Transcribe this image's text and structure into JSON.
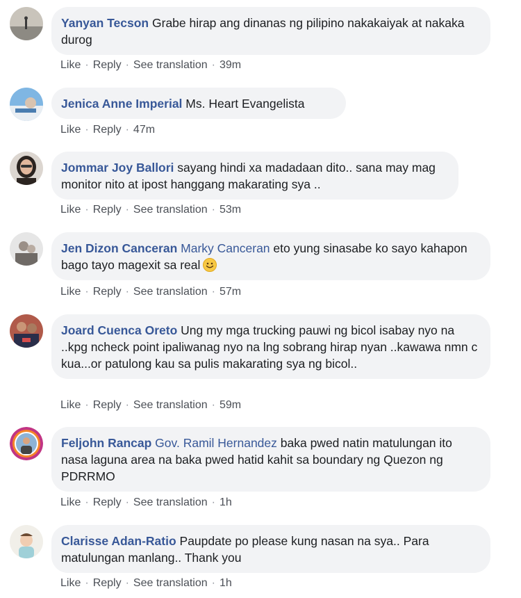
{
  "comments": [
    {
      "author": "Yanyan Tecson",
      "mention": "",
      "text": "Grabe hirap ang dinanas ng pilipino nakakaiyak at nakaka durog",
      "actions": {
        "like": "Like",
        "reply": "Reply",
        "translate": "See translation",
        "time": "39m"
      }
    },
    {
      "author": "Jenica Anne Imperial",
      "mention": "",
      "text": "Ms. Heart Evangelista",
      "actions": {
        "like": "Like",
        "reply": "Reply",
        "translate": "",
        "time": "47m"
      }
    },
    {
      "author": "Jommar Joy Ballori",
      "mention": "",
      "text": "sayang hindi xa madadaan dito.. sana may mag monitor nito at ipost hanggang makarating sya ..",
      "actions": {
        "like": "Like",
        "reply": "Reply",
        "translate": "See translation",
        "time": "53m"
      }
    },
    {
      "author": "Jen Dizon Canceran",
      "mention": "Marky Canceran",
      "text": "eto yung sinasabe ko sayo kahapon bago tayo magexit sa real",
      "emoji": "smiley-emoji",
      "actions": {
        "like": "Like",
        "reply": "Reply",
        "translate": "See translation",
        "time": "57m"
      }
    },
    {
      "author": "Joard Cuenca Oreto",
      "mention": "",
      "text": "Ung my mga trucking pauwi ng bicol isabay nyo na ..kpg ncheck point ipaliwanag nyo na lng sobrang hirap nyan ..kawawa nmn c kua...or patulong kau sa pulis makarating sya ng bicol..",
      "actions": {
        "like": "Like",
        "reply": "Reply",
        "translate": "See translation",
        "time": "59m"
      }
    },
    {
      "author": "Feljohn Rancap",
      "mention": "Gov. Ramil Hernandez",
      "text": "baka pwed natin matulungan ito nasa laguna area na baka pwed hatid kahit sa boundary ng Quezon ng PDRRMO",
      "actions": {
        "like": "Like",
        "reply": "Reply",
        "translate": "See translation",
        "time": "1h"
      }
    },
    {
      "author": "Clarisse Adan-Ratio",
      "mention": "",
      "text": "Paupdate po please kung nasan na sya.. Para matulungan manlang.. Thank you",
      "actions": {
        "like": "Like",
        "reply": "Reply",
        "translate": "See translation",
        "time": "1h"
      }
    }
  ],
  "colors": {
    "author": "#385898",
    "bubble": "#f2f3f5",
    "action": "#4b4f56"
  }
}
